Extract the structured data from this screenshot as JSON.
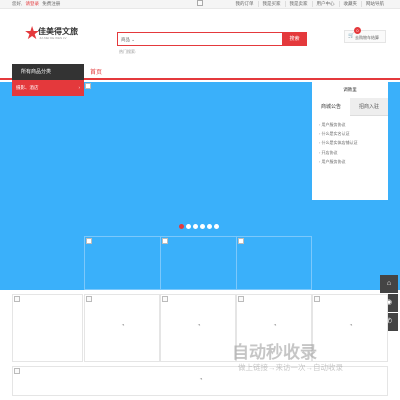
{
  "topbar": {
    "greeting": "您好,",
    "login": "请登录",
    "register": "免费注册",
    "links": [
      "我的订单",
      "我是买家",
      "我是卖家",
      "用户中心",
      "收藏夹",
      "网站导航"
    ]
  },
  "header": {
    "logo_name": "佳美得文旅",
    "logo_sub": "JIA MEI DE WEN LV",
    "search_category": "商品",
    "search_button": "搜索",
    "hot_label": "热门搜索:",
    "cart_label": "去购物车结算",
    "cart_count": "0"
  },
  "nav": {
    "all_categories": "所有商品分类",
    "home": "首页",
    "category_item": "摄影、酒店"
  },
  "carousel": {
    "slide_count": 6,
    "active_index": 0
  },
  "side": {
    "welcome": "调教里",
    "tabs": [
      "商城公告",
      "招商入驻"
    ],
    "notices": [
      "用户服务协议",
      "什么是实名认证",
      "什么是实体店铺认证",
      "开店协议",
      "用户服务协议"
    ]
  },
  "colors": {
    "accent": "#e4393c",
    "hero_bg": "#3ab0fa"
  },
  "watermark": {
    "title": "自动秒收录",
    "subtitle": "做上链接→来访一次→自动收录"
  },
  "icons": {
    "cart": "cart-icon",
    "spinner": "loading-icon",
    "sidebar": [
      "home-icon",
      "qq-icon",
      "phone-icon"
    ]
  }
}
